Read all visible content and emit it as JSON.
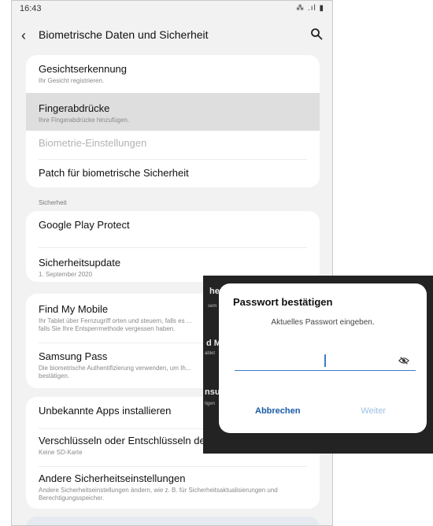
{
  "status": {
    "time": "16:43",
    "icons": "⁂ .ıl ▮"
  },
  "header": {
    "title": "Biometrische Daten und Sicherheit",
    "back_icon": "chevron-left-icon",
    "search_icon": "search-icon"
  },
  "biometrics": [
    {
      "title": "Gesichtserkennung",
      "subtitle": "Ihr Gesicht registrieren."
    },
    {
      "title": "Fingerabdrücke",
      "subtitle": "Ihre Fingerabdrücke hinzufügen."
    },
    {
      "title": "Biometrie-Einstellungen"
    },
    {
      "title": "Patch für biometrische Sicherheit"
    }
  ],
  "section_label": "Sicherheit",
  "security": [
    {
      "title": "Google Play Protect"
    },
    {
      "title": "Sicherheitsupdate",
      "subtitle": "1. September 2020"
    }
  ],
  "services": [
    {
      "title": "Find My Mobile",
      "subtitle": "Ihr Tablet über Fernzugriff orten und steuern, falls es ... falls Sie Ihre Entsperrmethode vergessen haben."
    },
    {
      "title": "Samsung Pass",
      "subtitle": "Die biometrische Authentifizierung verwenden, um Ih... bestätigen."
    }
  ],
  "other": [
    {
      "title": "Unbekannte Apps installieren"
    },
    {
      "title": "Verschlüsseln oder Entschlüsseln der SD-Karte",
      "subtitle": "Keine SD-Karte"
    },
    {
      "title": "Andere Sicherheitseinstellungen",
      "subtitle": "Andere Sicherheitseinstellungen ändern, wie z. B. für Sicherheitsaktualisierungen und Berechtigungsspeicher."
    }
  ],
  "overlay_peek": {
    "a": "her",
    "b": "d M",
    "c": "nsu",
    "small_a": "sem",
    "small_b": "ablet",
    "small_c": "tigen"
  },
  "dialog": {
    "title": "Passwort bestätigen",
    "subtitle": "Aktuelles Passwort eingeben.",
    "input_value": "",
    "eye_icon": "eye-off-icon",
    "cancel": "Abbrechen",
    "next": "Weiter"
  },
  "colors": {
    "accent": "#1a5aa8",
    "disabled_accent": "#9cc0e6",
    "highlight": "#dedede"
  }
}
